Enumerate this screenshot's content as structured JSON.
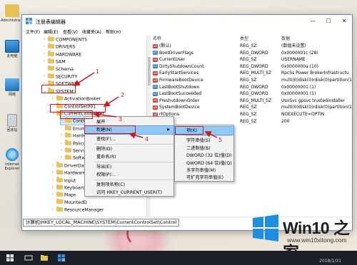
{
  "desktop": {
    "icons": [
      {
        "label": "Administra...",
        "icon": "user-folder-icon"
      },
      {
        "label": "此电脑",
        "icon": "computer-icon"
      },
      {
        "label": "网络",
        "icon": "network-icon"
      },
      {
        "label": "回收站",
        "icon": "recycle-bin-icon"
      },
      {
        "label": "Internet Explorer",
        "icon": "ie-icon"
      }
    ]
  },
  "window": {
    "title": "注册表编辑器",
    "buttons": {
      "minimize": "—",
      "maximize": "☐",
      "close": "✕"
    }
  },
  "menubar": [
    "文件(F)",
    "编辑(E)",
    "查看(V)",
    "收藏夹(A)",
    "帮助(H)"
  ],
  "tree": {
    "items": [
      {
        "label": "COMPONENTS"
      },
      {
        "label": "DRIVERS"
      },
      {
        "label": "HARDWARE"
      },
      {
        "label": "SAM"
      },
      {
        "label": "Schema"
      },
      {
        "label": "SECURITY"
      },
      {
        "label": "SOFTWARE"
      },
      {
        "label": "SYSTEM"
      },
      {
        "label": "ActivationBroker"
      },
      {
        "label": "ControlSet001"
      },
      {
        "label": "CurrentControlSet"
      },
      {
        "label": "Control"
      },
      {
        "label": "Enum"
      },
      {
        "label": "Hardw"
      },
      {
        "label": "Policies"
      },
      {
        "label": "Service"
      },
      {
        "label": "Softwa"
      },
      {
        "label": "DriverDat"
      },
      {
        "label": "Hardware"
      },
      {
        "label": "Input"
      },
      {
        "label": "Keyboard"
      },
      {
        "label": "Maps"
      },
      {
        "label": "MountedD"
      },
      {
        "label": "ResourceManager"
      }
    ]
  },
  "list": {
    "headers": {
      "name": "名称",
      "type": "类型",
      "data": "数据"
    },
    "rows": [
      {
        "name": "(默认)",
        "type": "REG_SZ",
        "data": "(数值未设置)",
        "kind": "str"
      },
      {
        "name": "BootDriverFlags",
        "type": "REG_DWORD",
        "data": "0x0000001c (28)",
        "kind": "num"
      },
      {
        "name": "CurrentUser",
        "type": "REG_SZ",
        "data": "USERNAME",
        "kind": "str"
      },
      {
        "name": "DirtyShutdownCount",
        "type": "REG_DWORD",
        "data": "0x0000000a (10)",
        "kind": "num"
      },
      {
        "name": "EarlyStartServices",
        "type": "REG_MULTI_SZ",
        "data": "RpcSs Power BrokerInfrastructu",
        "kind": "str"
      },
      {
        "name": "FirmwareBootDevice",
        "type": "REG_SZ",
        "data": "multi(0)disk(0)rdisk(0)partition(1",
        "kind": "str"
      },
      {
        "name": "LastBootShutdown",
        "type": "REG_DWORD",
        "data": "0x00000001 (1)",
        "kind": "num"
      },
      {
        "name": "LastBootSucceeded",
        "type": "REG_DWORD",
        "data": "0x00000001 (1)",
        "kind": "num"
      },
      {
        "name": "PreshutdownOrder",
        "type": "REG_MULTI_SZ",
        "data": "UsoSvc gpsvc trustedinstaller",
        "kind": "str"
      },
      {
        "name": "SystemBootDevice",
        "type": "REG_SZ",
        "data": "multi(0)disk(0)rdisk(0)partition(1",
        "kind": "str"
      },
      {
        "name": "rtOptions",
        "type": "REG_SZ",
        "data": "NOEXECUTE=OPTIN",
        "kind": "str"
      },
      {
        "name": "",
        "type": "REG_SZ",
        "data": "200",
        "kind": "str"
      }
    ]
  },
  "statusbar": {
    "path": "计算机\\HKEY_LOCAL_MACHINE\\SYSTEM\\CurrentControlSet\\Control"
  },
  "context_menu": {
    "items": [
      {
        "label": "展开"
      },
      {
        "label": "新建(N)",
        "submenu": true
      },
      {
        "label": "查找(F)..."
      },
      {
        "label": "删除(D)"
      },
      {
        "label": "重命名(R)"
      },
      {
        "label": "导出(E)"
      },
      {
        "label": "权限(P)..."
      },
      {
        "label": "复制项名称(C)"
      },
      {
        "label": "访问 HKEY_CURRENT_USER(T)"
      }
    ]
  },
  "sub_menu": {
    "items": [
      {
        "label": "项(K)"
      },
      {
        "label": "字符串值(S)"
      },
      {
        "label": "二进制值(B)"
      },
      {
        "label": "DWORD (32 位)值(D)"
      },
      {
        "label": "QWORD (64 位)值(Q)"
      },
      {
        "label": "多字符串值(M)"
      },
      {
        "label": "可扩充字符串值(E)"
      }
    ]
  },
  "annotations": [
    "1",
    "2",
    "3",
    "4",
    "5"
  ],
  "watermark": {
    "title": "Win10 之家",
    "url": "www.win10xitong.com"
  },
  "taskbar": {
    "time": "2018/1/31"
  },
  "colors": {
    "accent": "#0078d7",
    "annotation": "#d0161b",
    "selection": "#cce4f7",
    "menu_highlight": "#91c9f7"
  }
}
